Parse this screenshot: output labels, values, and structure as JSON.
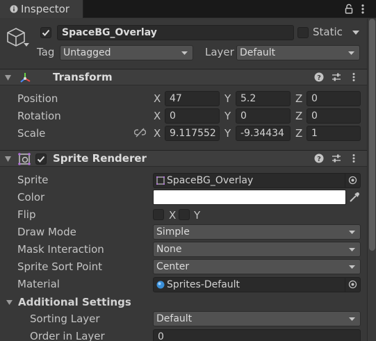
{
  "tab": {
    "icon": "info-icon",
    "label": "Inspector"
  },
  "toolbar_icons": [
    "lock-icon",
    "kebab-menu-icon"
  ],
  "object": {
    "icon": "cube-icon",
    "name": "SpaceBG_Overlay",
    "active": true,
    "static_label": "Static",
    "static_checked": false,
    "tag_label": "Tag",
    "tag_value": "Untagged",
    "layer_label": "Layer",
    "layer_value": "Default"
  },
  "transform": {
    "title": "Transform",
    "rows": [
      {
        "label": "Position",
        "x": "47",
        "y": "5.2",
        "z": "0"
      },
      {
        "label": "Rotation",
        "x": "0",
        "y": "0",
        "z": "0"
      },
      {
        "label": "Scale",
        "x": "9.117552",
        "y": "-9.34434",
        "z": "1"
      }
    ],
    "axis": {
      "x": "X",
      "y": "Y",
      "z": "Z"
    }
  },
  "sprite_renderer": {
    "title": "Sprite Renderer",
    "enabled": true,
    "sprite_label": "Sprite",
    "sprite_value": "SpaceBG_Overlay",
    "color_label": "Color",
    "color_value": "#ffffff",
    "flip_label": "Flip",
    "flip_x_label": "X",
    "flip_y_label": "Y",
    "draw_mode_label": "Draw Mode",
    "draw_mode_value": "Simple",
    "mask_label": "Mask Interaction",
    "mask_value": "None",
    "sort_point_label": "Sprite Sort Point",
    "sort_point_value": "Center",
    "material_label": "Material",
    "material_value": "Sprites-Default",
    "additional_title": "Additional Settings",
    "sorting_layer_label": "Sorting Layer",
    "sorting_layer_value": "Default",
    "order_label": "Order in Layer",
    "order_value": "0"
  }
}
